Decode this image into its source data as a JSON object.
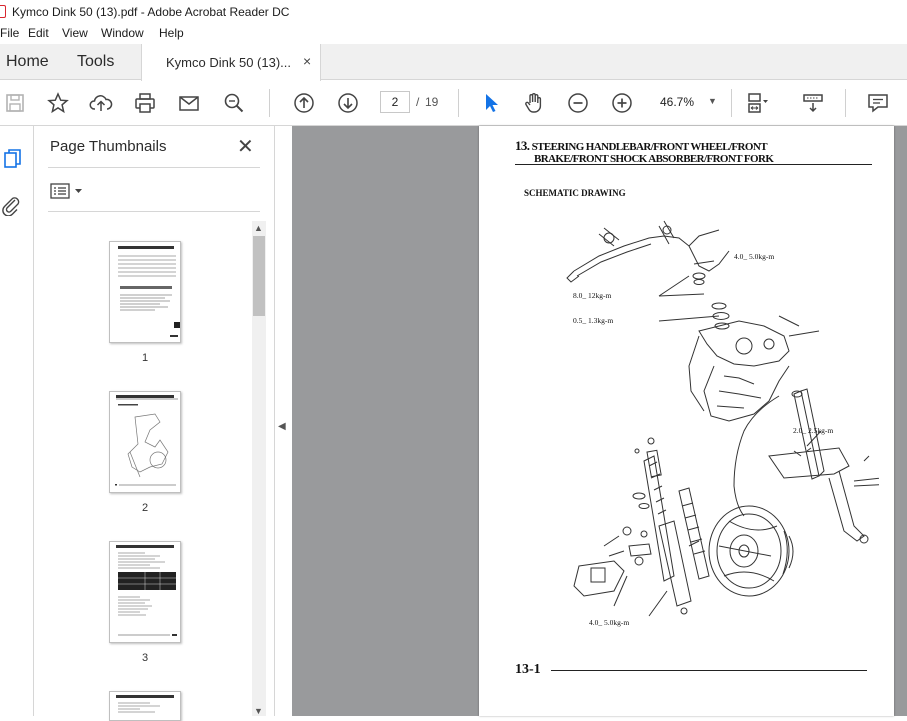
{
  "window": {
    "title": "Kymco Dink 50 (13).pdf - Adobe Acrobat Reader DC"
  },
  "menu": [
    "File",
    "Edit",
    "View",
    "Window",
    "Help"
  ],
  "tabs": {
    "home": "Home",
    "tools": "Tools",
    "document": "Kymco Dink 50 (13)...",
    "close": "×"
  },
  "toolbar": {
    "icons": [
      "save-icon",
      "bookmark-star-icon",
      "upload-cloud-icon",
      "print-icon",
      "mail-icon",
      "zoom-search-icon",
      "page-up-icon",
      "page-down-icon",
      "select-arrow-icon",
      "hand-icon",
      "zoom-out-icon",
      "zoom-in-icon",
      "fit-page-icon",
      "scroll-mode-icon",
      "comment-icon"
    ],
    "current_page": "2",
    "page_separator": "/",
    "total_pages": "19",
    "zoom": "46.7%"
  },
  "panel": {
    "title": "Page Thumbnails",
    "close": "✕",
    "thumbnails": [
      {
        "label": "1"
      },
      {
        "label": "2"
      },
      {
        "label": "3"
      }
    ]
  },
  "document": {
    "heading_number": "13.",
    "heading_line1": "STEERING HANDLEBAR/FRONT WHEEL/FRONT",
    "heading_line2": "BRAKE/FRONT SHOCK ABSORBER/FRONT FORK",
    "subheading": "SCHEMATIC DRAWING",
    "torques": [
      "4.0_    5.0kg-m",
      "8.0_    12kg-m",
      "0.5_    1.3kg-m",
      "2.0_    2.5kg-m",
      "4.0_    5.0kg-m"
    ],
    "page_number": "13-1"
  },
  "colors": {
    "viewer_bg": "#999a9c",
    "accent_blue": "#1473e6",
    "pdf_red": "#d8262f"
  }
}
